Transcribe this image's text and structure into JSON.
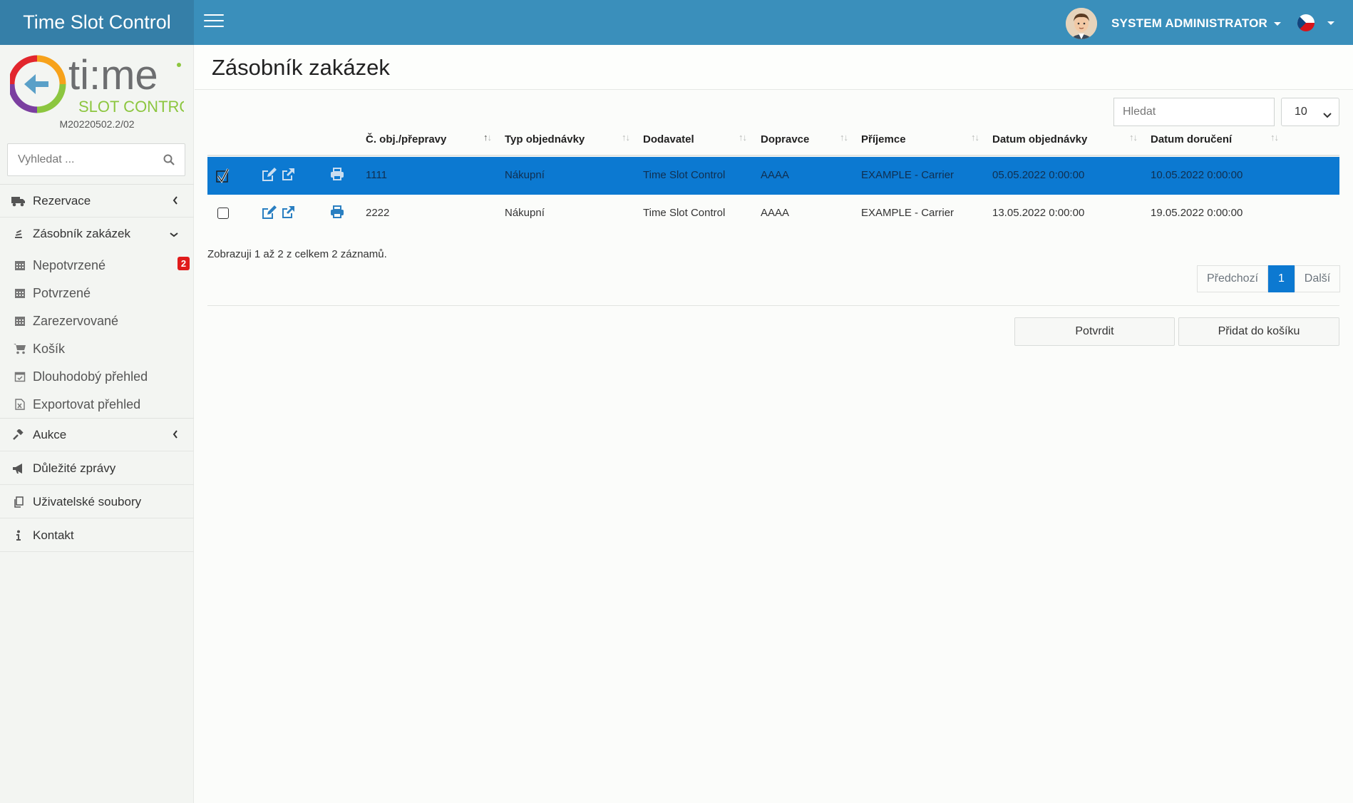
{
  "header": {
    "brand": "Time Slot Control",
    "user_name": "SYSTEM ADMINISTRATOR"
  },
  "sidebar": {
    "version": "M20220502.2/02",
    "search_placeholder": "Vyhledat ...",
    "nav": {
      "rezervace": "Rezervace",
      "zasobnik": "Zásobník zakázek",
      "nepotvrzene": "Nepotvrzené",
      "nepotvrzene_badge": "2",
      "potvrzene": "Potvrzené",
      "zarezervovane": "Zarezervované",
      "kosik": "Košík",
      "dlouhodoby": "Dlouhodobý přehled",
      "exportovat": "Exportovat přehled",
      "aukce": "Aukce",
      "zpravy": "Důležité zprávy",
      "soubory": "Uživatelské soubory",
      "kontakt": "Kontakt"
    }
  },
  "page": {
    "title": "Zásobník zakázek",
    "search_placeholder": "Hledat",
    "page_size": "10"
  },
  "table": {
    "columns": [
      "Č. obj./přepravy",
      "Typ objednávky",
      "Dodavatel",
      "Dopravce",
      "Příjemce",
      "Datum objednávky",
      "Datum doručení"
    ],
    "rows": [
      {
        "selected": true,
        "cells": [
          "1111",
          "Nákupní",
          "Time Slot Control",
          "AAAA",
          "EXAMPLE - Carrier",
          "05.05.2022 0:00:00",
          "10.05.2022 0:00:00"
        ]
      },
      {
        "selected": false,
        "cells": [
          "2222",
          "Nákupní",
          "Time Slot Control",
          "AAAA",
          "EXAMPLE - Carrier",
          "13.05.2022 0:00:00",
          "19.05.2022 0:00:00"
        ]
      }
    ],
    "info": "Zobrazuji 1 až 2 z celkem 2 záznamů."
  },
  "pagination": {
    "prev": "Předchozí",
    "current": "1",
    "next": "Další"
  },
  "actions": {
    "confirm": "Potvrdit",
    "add_to_cart": "Přidat do košíku"
  },
  "colors": {
    "header": "#3a8fbb",
    "brand_bg": "#357fa8",
    "selected_row": "#0c79d1",
    "badge": "#e01b1b",
    "icon_blue": "#2a7fc1"
  }
}
